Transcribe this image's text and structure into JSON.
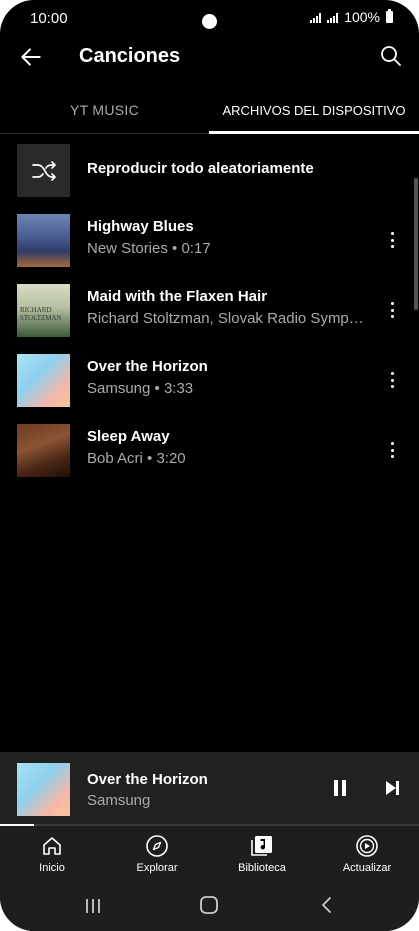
{
  "status_bar": {
    "time": "10:00",
    "battery": "100%"
  },
  "header": {
    "title": "Canciones",
    "back_icon": "arrow-left-icon",
    "search_icon": "search-icon"
  },
  "tabs": [
    {
      "label": "YT MUSIC",
      "selected": false
    },
    {
      "label": "ARCHIVOS DEL DISPOSITIVO",
      "selected": true
    }
  ],
  "shuffle": {
    "label": "Reproducir todo aleatoriamente",
    "icon": "shuffle-icon"
  },
  "songs": [
    {
      "title": "Highway Blues",
      "subtitle": "New Stories • 0:17"
    },
    {
      "title": "Maid with the Flaxen Hair",
      "subtitle": "Richard Stoltzman, Slovak Radio Symph…",
      "art_text": "RICHARD STOLTZMAN"
    },
    {
      "title": "Over the Horizon",
      "subtitle": "Samsung • 3:33"
    },
    {
      "title": "Sleep Away",
      "subtitle": "Bob Acri • 3:20"
    }
  ],
  "mini_player": {
    "title": "Over the Horizon",
    "artist": "Samsung",
    "state": "playing",
    "progress": 0.08
  },
  "bottom_nav": [
    {
      "label": "Inicio",
      "icon": "home-icon",
      "selected": false
    },
    {
      "label": "Explorar",
      "icon": "compass-icon",
      "selected": false
    },
    {
      "label": "Biblioteca",
      "icon": "library-icon",
      "selected": true
    },
    {
      "label": "Actualizar",
      "icon": "upgrade-icon",
      "selected": false
    }
  ],
  "colors": {
    "background": "#000000",
    "secondary_text": "#aaaaaa",
    "mini_player_bg": "#212121",
    "nav_bg": "#1e1e1e"
  }
}
